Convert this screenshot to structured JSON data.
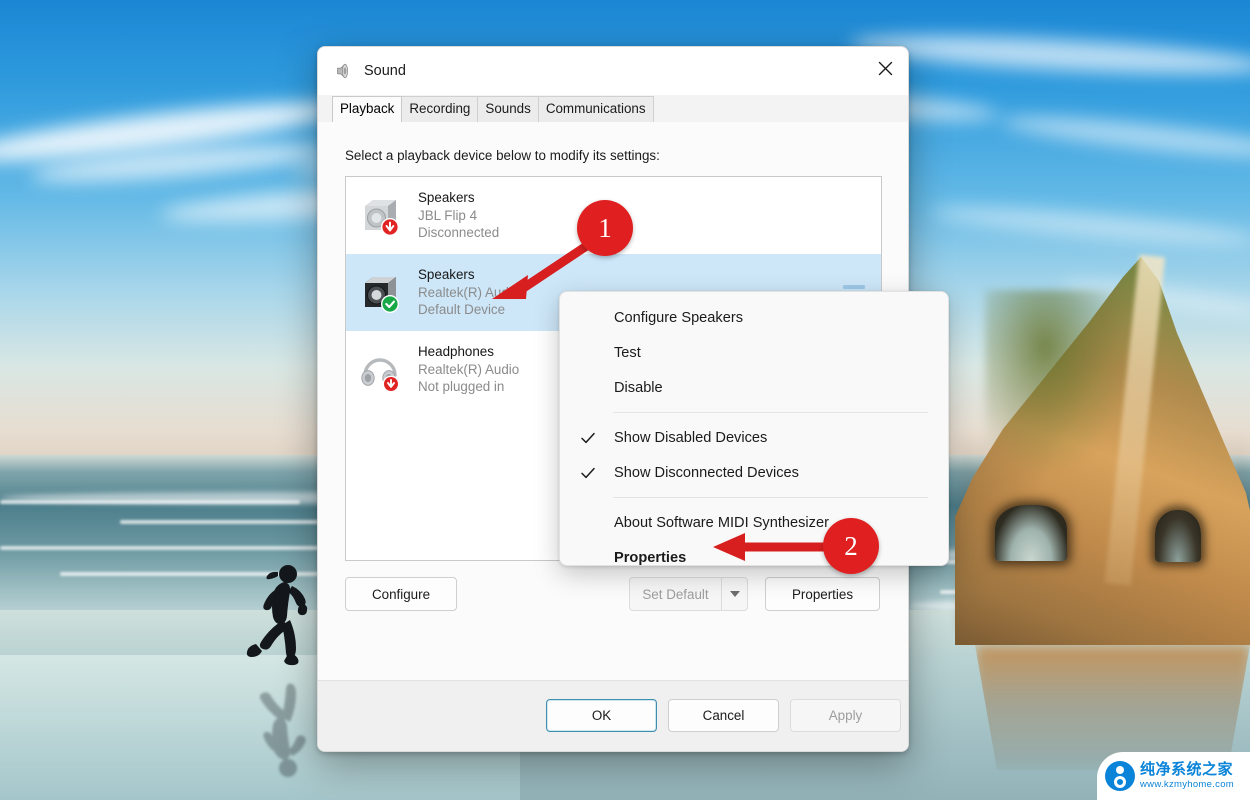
{
  "dialog": {
    "title": "Sound",
    "title_icon": "speaker-icon",
    "close_label": "✕",
    "tabs": [
      {
        "label": "Playback",
        "active": true
      },
      {
        "label": "Recording",
        "active": false
      },
      {
        "label": "Sounds",
        "active": false
      },
      {
        "label": "Communications",
        "active": false
      }
    ],
    "hint": "Select a playback device below to modify its settings:",
    "devices": [
      {
        "name": "Speakers",
        "driver": "JBL Flip 4",
        "status": "Disconnected",
        "icon": "speaker-box-icon",
        "badge": "red-down-arrow-badge",
        "selected": false
      },
      {
        "name": "Speakers",
        "driver": "Realtek(R) Audio",
        "status": "Default Device",
        "icon": "speaker-box-icon",
        "badge": "green-check-badge",
        "selected": true
      },
      {
        "name": "Headphones",
        "driver": "Realtek(R) Audio",
        "status": "Not plugged in",
        "icon": "headphones-icon",
        "badge": "red-down-arrow-badge",
        "selected": false
      }
    ],
    "buttons": {
      "configure": "Configure",
      "set_default": "Set Default",
      "set_default_arrow_icon": "chevron-down-icon",
      "properties": "Properties",
      "ok": "OK",
      "cancel": "Cancel",
      "apply": "Apply"
    }
  },
  "context_menu": {
    "items": [
      {
        "label": "Configure Speakers",
        "checked": false,
        "bold": false
      },
      {
        "label": "Test",
        "checked": false,
        "bold": false
      },
      {
        "label": "Disable",
        "checked": false,
        "bold": false
      },
      {
        "separator": true
      },
      {
        "label": "Show Disabled Devices",
        "checked": true,
        "bold": false
      },
      {
        "label": "Show Disconnected Devices",
        "checked": true,
        "bold": false
      },
      {
        "separator": true
      },
      {
        "label": "About Software MIDI Synthesizer",
        "checked": false,
        "bold": false
      },
      {
        "label": "Properties",
        "checked": false,
        "bold": true
      }
    ]
  },
  "callouts": [
    {
      "number": "1"
    },
    {
      "number": "2"
    }
  ],
  "watermark": {
    "name": "纯净系统之家",
    "url": "www.kzmyhome.com"
  },
  "colors": {
    "accent_red": "#e02020",
    "selection_blue": "#cde7f9",
    "focus_blue": "#3f8fb0",
    "brand_blue": "#0a84d8"
  }
}
